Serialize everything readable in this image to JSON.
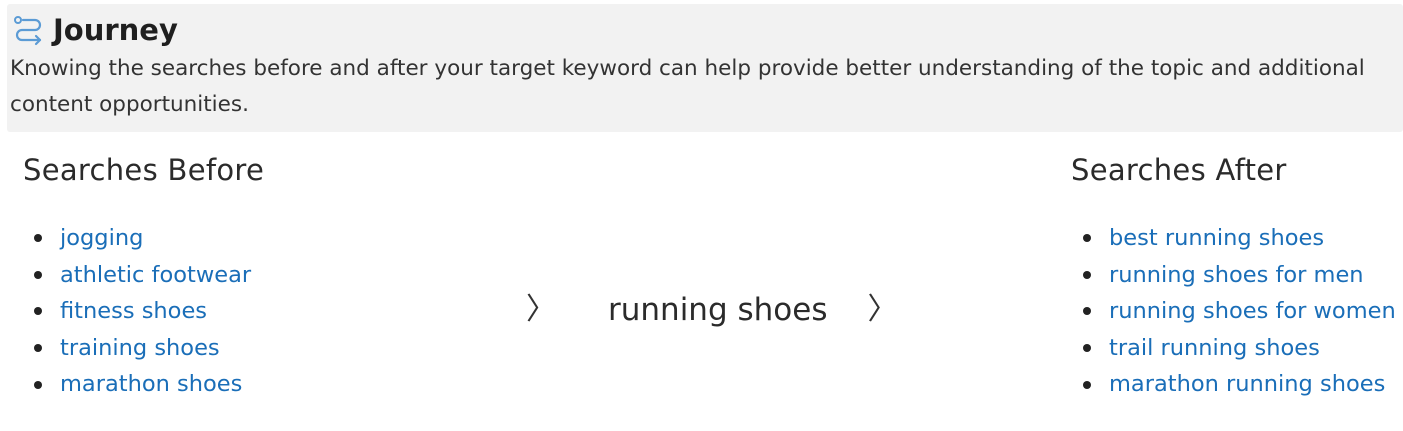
{
  "header": {
    "icon": "route-icon",
    "title": "Journey",
    "description": "Knowing the searches before and after your target keyword can help provide better understanding of the topic and additional content opportunities."
  },
  "before": {
    "heading": "Searches Before",
    "items": [
      {
        "label": "jogging"
      },
      {
        "label": "athletic footwear"
      },
      {
        "label": "fitness shoes"
      },
      {
        "label": "training shoes"
      },
      {
        "label": "marathon shoes"
      }
    ]
  },
  "center": {
    "left_chevron": "〉",
    "keyword": "running shoes",
    "right_chevron": "〉"
  },
  "after": {
    "heading": "Searches After",
    "items": [
      {
        "label": "best running shoes"
      },
      {
        "label": "running shoes for men"
      },
      {
        "label": "running shoes for women"
      },
      {
        "label": "trail running shoes"
      },
      {
        "label": "marathon running shoes"
      }
    ]
  },
  "colors": {
    "link": "#1a6eb8",
    "icon": "#5b9bd5",
    "header_bg": "#f2f2f2"
  }
}
